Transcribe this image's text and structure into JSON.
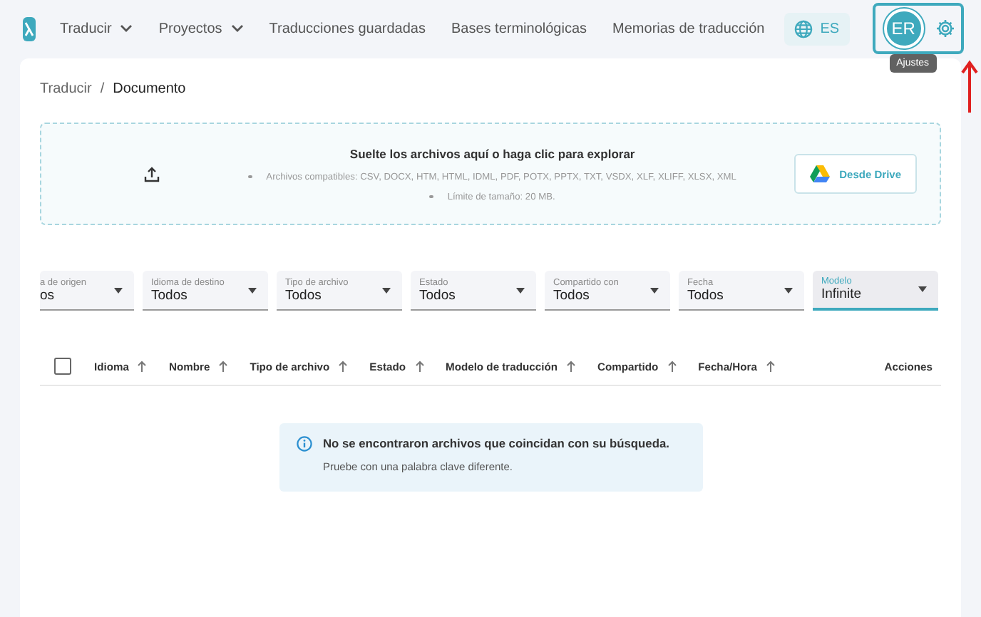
{
  "nav": {
    "menu": [
      {
        "label": "Traducir",
        "dropdown": true
      },
      {
        "label": "Proyectos",
        "dropdown": true
      },
      {
        "label": "Traducciones guardadas",
        "dropdown": false
      },
      {
        "label": "Bases terminológicas",
        "dropdown": false
      },
      {
        "label": "Memorias de traducción",
        "dropdown": false
      }
    ],
    "language": "ES",
    "avatar": "ER",
    "tooltip": "Ajustes"
  },
  "breadcrumb": {
    "items": [
      "Traducir",
      "Documento"
    ],
    "separator": "/"
  },
  "upload": {
    "title": "Suelte los archivos aquí o haga clic para explorar",
    "items": [
      "Archivos compatibles: CSV, DOCX, HTM, HTML, IDML, PDF, POTX, PPTX, TXT, VSDX, XLF, XLIFF, XLSX, XML",
      "Límite de tamaño: 20 MB."
    ],
    "drive_button": "Desde Drive"
  },
  "filters": [
    {
      "label": "a de origen",
      "value": "os",
      "focused": false
    },
    {
      "label": "Idioma de destino",
      "value": "Todos",
      "focused": false
    },
    {
      "label": "Tipo de archivo",
      "value": "Todos",
      "focused": false
    },
    {
      "label": "Estado",
      "value": "Todos",
      "focused": false
    },
    {
      "label": "Compartido con",
      "value": "Todos",
      "focused": false
    },
    {
      "label": "Fecha",
      "value": "Todos",
      "focused": false
    },
    {
      "label": "Modelo",
      "value": "Infinite",
      "focused": true
    }
  ],
  "table": {
    "select_all": {
      "checked": false
    },
    "columns": [
      {
        "label": "Idioma",
        "sortable": true
      },
      {
        "label": "Nombre",
        "sortable": true
      },
      {
        "label": "Tipo de archivo",
        "sortable": true
      },
      {
        "label": "Estado",
        "sortable": true
      },
      {
        "label": "Modelo de traducción",
        "sortable": true
      },
      {
        "label": "Compartido",
        "sortable": true
      },
      {
        "label": "Fecha/Hora",
        "sortable": true
      },
      {
        "label": "Acciones",
        "sortable": false
      }
    ]
  },
  "empty_state": {
    "title": "No se encontraron archivos que coincidan con su búsqueda.",
    "hint": "Pruebe con una palabra clave diferente."
  }
}
